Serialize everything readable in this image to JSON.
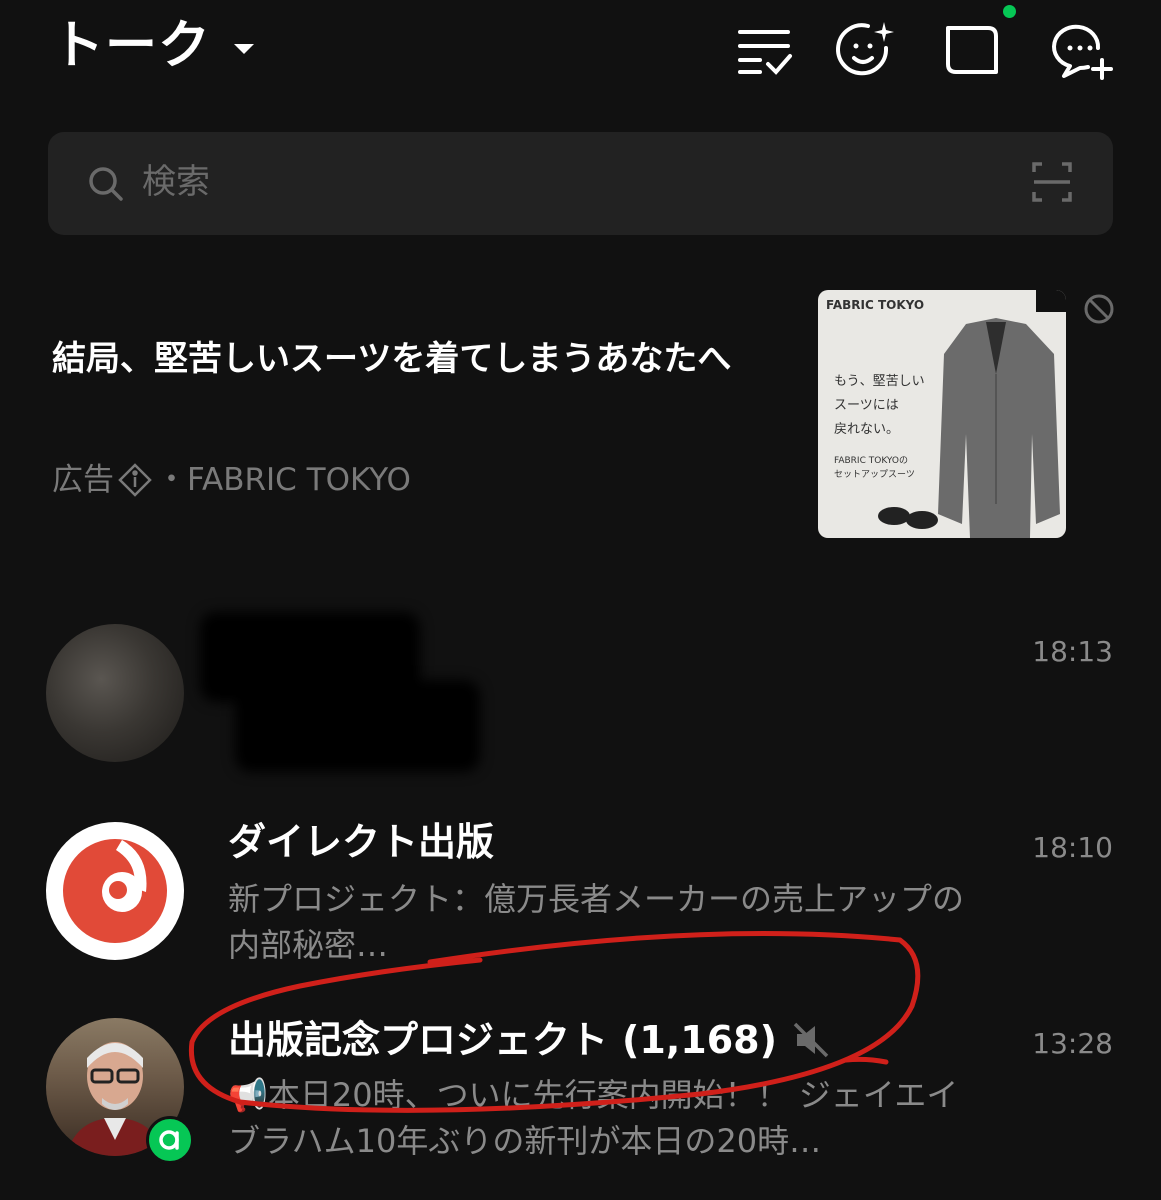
{
  "header": {
    "title": "トーク",
    "icons": [
      "filter-list-icon",
      "face-sparkle-icon",
      "square-icon",
      "new-chat-icon"
    ],
    "accent": "#06c755"
  },
  "search": {
    "placeholder": "検索"
  },
  "ad": {
    "title": "結局、堅苦しいスーツを着てしまうあなたへ",
    "label": "広告",
    "separator": "・",
    "advertiser": "FABRIC TOKYO",
    "image": {
      "brand": "FABRIC TOKYO",
      "line1": "もう、堅苦しい",
      "line2": "スーツには",
      "line3": "戻れない。",
      "sub1": "FABRIC TOKYOの",
      "sub2": "セットアップスーツ"
    }
  },
  "chats": [
    {
      "name": "",
      "preview": "",
      "time": "18:13"
    },
    {
      "name": "ダイレクト出版",
      "preview": "新プロジェクト：億万長者メーカーの売上アップの内部秘密…",
      "time": "18:10"
    },
    {
      "name": "出版記念プロジェクト",
      "count": "(1,168)",
      "preview": "📢本日20時、ついに先行案内開始！！ ジェイエイブラハム10年ぶりの新刊が本日の20時…",
      "time": "13:28"
    }
  ]
}
